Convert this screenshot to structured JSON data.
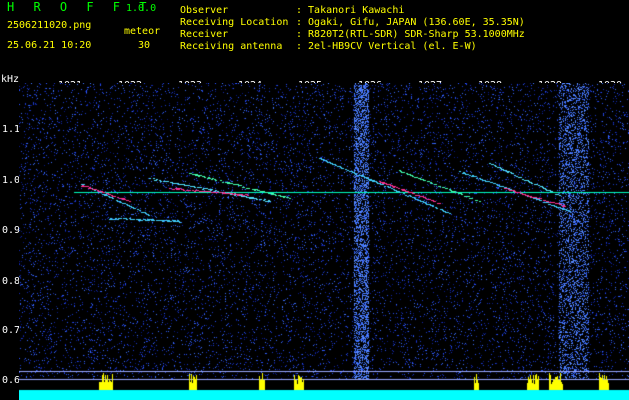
{
  "app": {
    "title": "H R O F F T",
    "version": "1.0.0",
    "filename": "2506211020.png",
    "datetime": "25.06.21 10:20",
    "meteor_label": "meteor",
    "meteor_count": "30"
  },
  "info": {
    "observer_label": "Observer",
    "observer_value": ": Takanori Kawachi",
    "location_label": "Receiving Location",
    "location_value": ": Ogaki, Gifu, JAPAN (136.60E, 35.35N)",
    "receiver_label": "Receiver",
    "receiver_value": ": R820T2(RTL-SDR) SDR-Sharp 53.1000MHz",
    "antenna_label": "Receiving antenna",
    "antenna_value": ": 2el-HB9CV Vertical (el. E-W)"
  },
  "axes": {
    "unit": "kHz",
    "x_ticks": [
      "1021",
      "1022",
      "1023",
      "1024",
      "1025",
      "1026",
      "1027",
      "1028",
      "1029",
      "1030"
    ],
    "y_ticks": [
      "1.1",
      "1.0",
      "0.9",
      "0.8",
      "0.7",
      "0.6"
    ]
  },
  "colors": {
    "background": "#000000",
    "spectrogram_noise": "#0a1aa0",
    "carrier_line": "#00ffc0",
    "meteor_head": "#ff2080",
    "signal_bars": "#ffff00",
    "baseline": "#00ffff"
  }
}
